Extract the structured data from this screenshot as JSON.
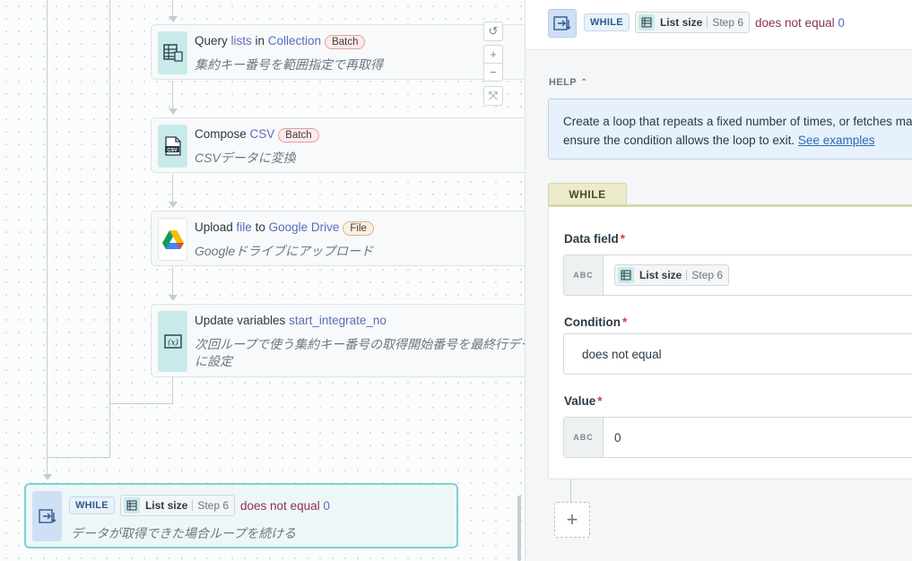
{
  "canvas": {
    "steps": [
      {
        "title_pre": "Query ",
        "title_kw1": "lists",
        "title_mid": " in ",
        "title_kw2": "Collection",
        "badge": "Batch",
        "desc": "集約キー番号を範囲指定で再取得",
        "icon": "collection-table-icon"
      },
      {
        "title_pre": "Compose ",
        "title_kw1": "CSV",
        "badge": "Batch",
        "desc": "CSVデータに変換",
        "icon": "csv-file-icon"
      },
      {
        "title_pre": "Upload ",
        "title_kw1": "file",
        "title_mid": " to ",
        "title_kw2": "Google Drive",
        "badge": "File",
        "desc": "Googleドライブにアップロード",
        "icon": "google-drive-icon"
      },
      {
        "title_pre": "Update variables ",
        "title_kw1": "start_integrate_no",
        "desc_line1": "次回ループで使う集約キー番号の取得開始番号を最終行デー",
        "desc_line2": "に設定",
        "icon": "variable-icon"
      }
    ],
    "while_node": {
      "tag": "WHILE",
      "pill_name": "List size",
      "pill_step": "Step 6",
      "cond_text": "does not equal",
      "cond_value": "0",
      "desc": "データが取得できた場合ループを続ける"
    },
    "zoom": {
      "reset": "↺",
      "zoom_in": "+",
      "zoom_out": "−",
      "fit": "⤧"
    }
  },
  "panel": {
    "header": {
      "tag": "WHILE",
      "pill_name": "List size",
      "pill_step": "Step 6",
      "cond_text": "does not equal",
      "cond_value": "0"
    },
    "help": {
      "label": "HELP",
      "text_line1": "Create a loop that repeats a fixed number of times, or fetches many",
      "text_line2": "ensure the condition allows the loop to exit. ",
      "link": "See examples"
    },
    "while_tab": "WHILE",
    "fields": {
      "data_field": {
        "label": "Data field",
        "required": "*",
        "type": "ABC",
        "pill_name": "List size",
        "pill_step": "Step 6"
      },
      "condition": {
        "label": "Condition",
        "required": "*",
        "value": "does not equal"
      },
      "value": {
        "label": "Value",
        "required": "*",
        "type": "ABC",
        "value": "0"
      }
    },
    "add_button": "+"
  }
}
